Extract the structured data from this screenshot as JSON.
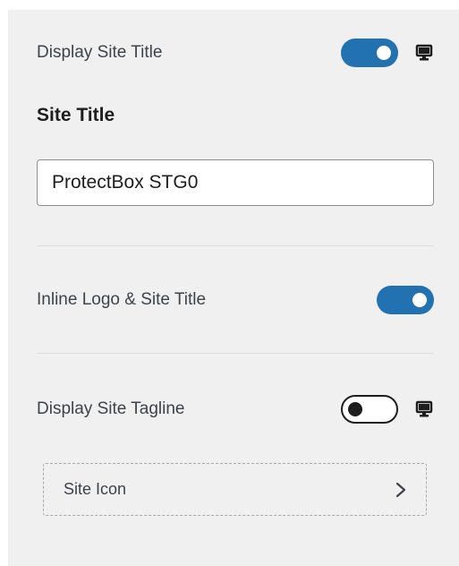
{
  "display_site_title": {
    "label": "Display Site Title",
    "enabled": true
  },
  "site_title": {
    "heading": "Site Title",
    "value": "ProtectBox STG0"
  },
  "inline_logo": {
    "label": "Inline Logo & Site Title",
    "enabled": true
  },
  "display_site_tagline": {
    "label": "Display Site Tagline",
    "enabled": false
  },
  "site_icon": {
    "label": "Site Icon"
  },
  "icons": {
    "device": "desktop-icon",
    "chevron": "chevron-right-icon"
  },
  "colors": {
    "toggle_on": "#2271b1",
    "panel_bg": "#f0f0f1"
  }
}
